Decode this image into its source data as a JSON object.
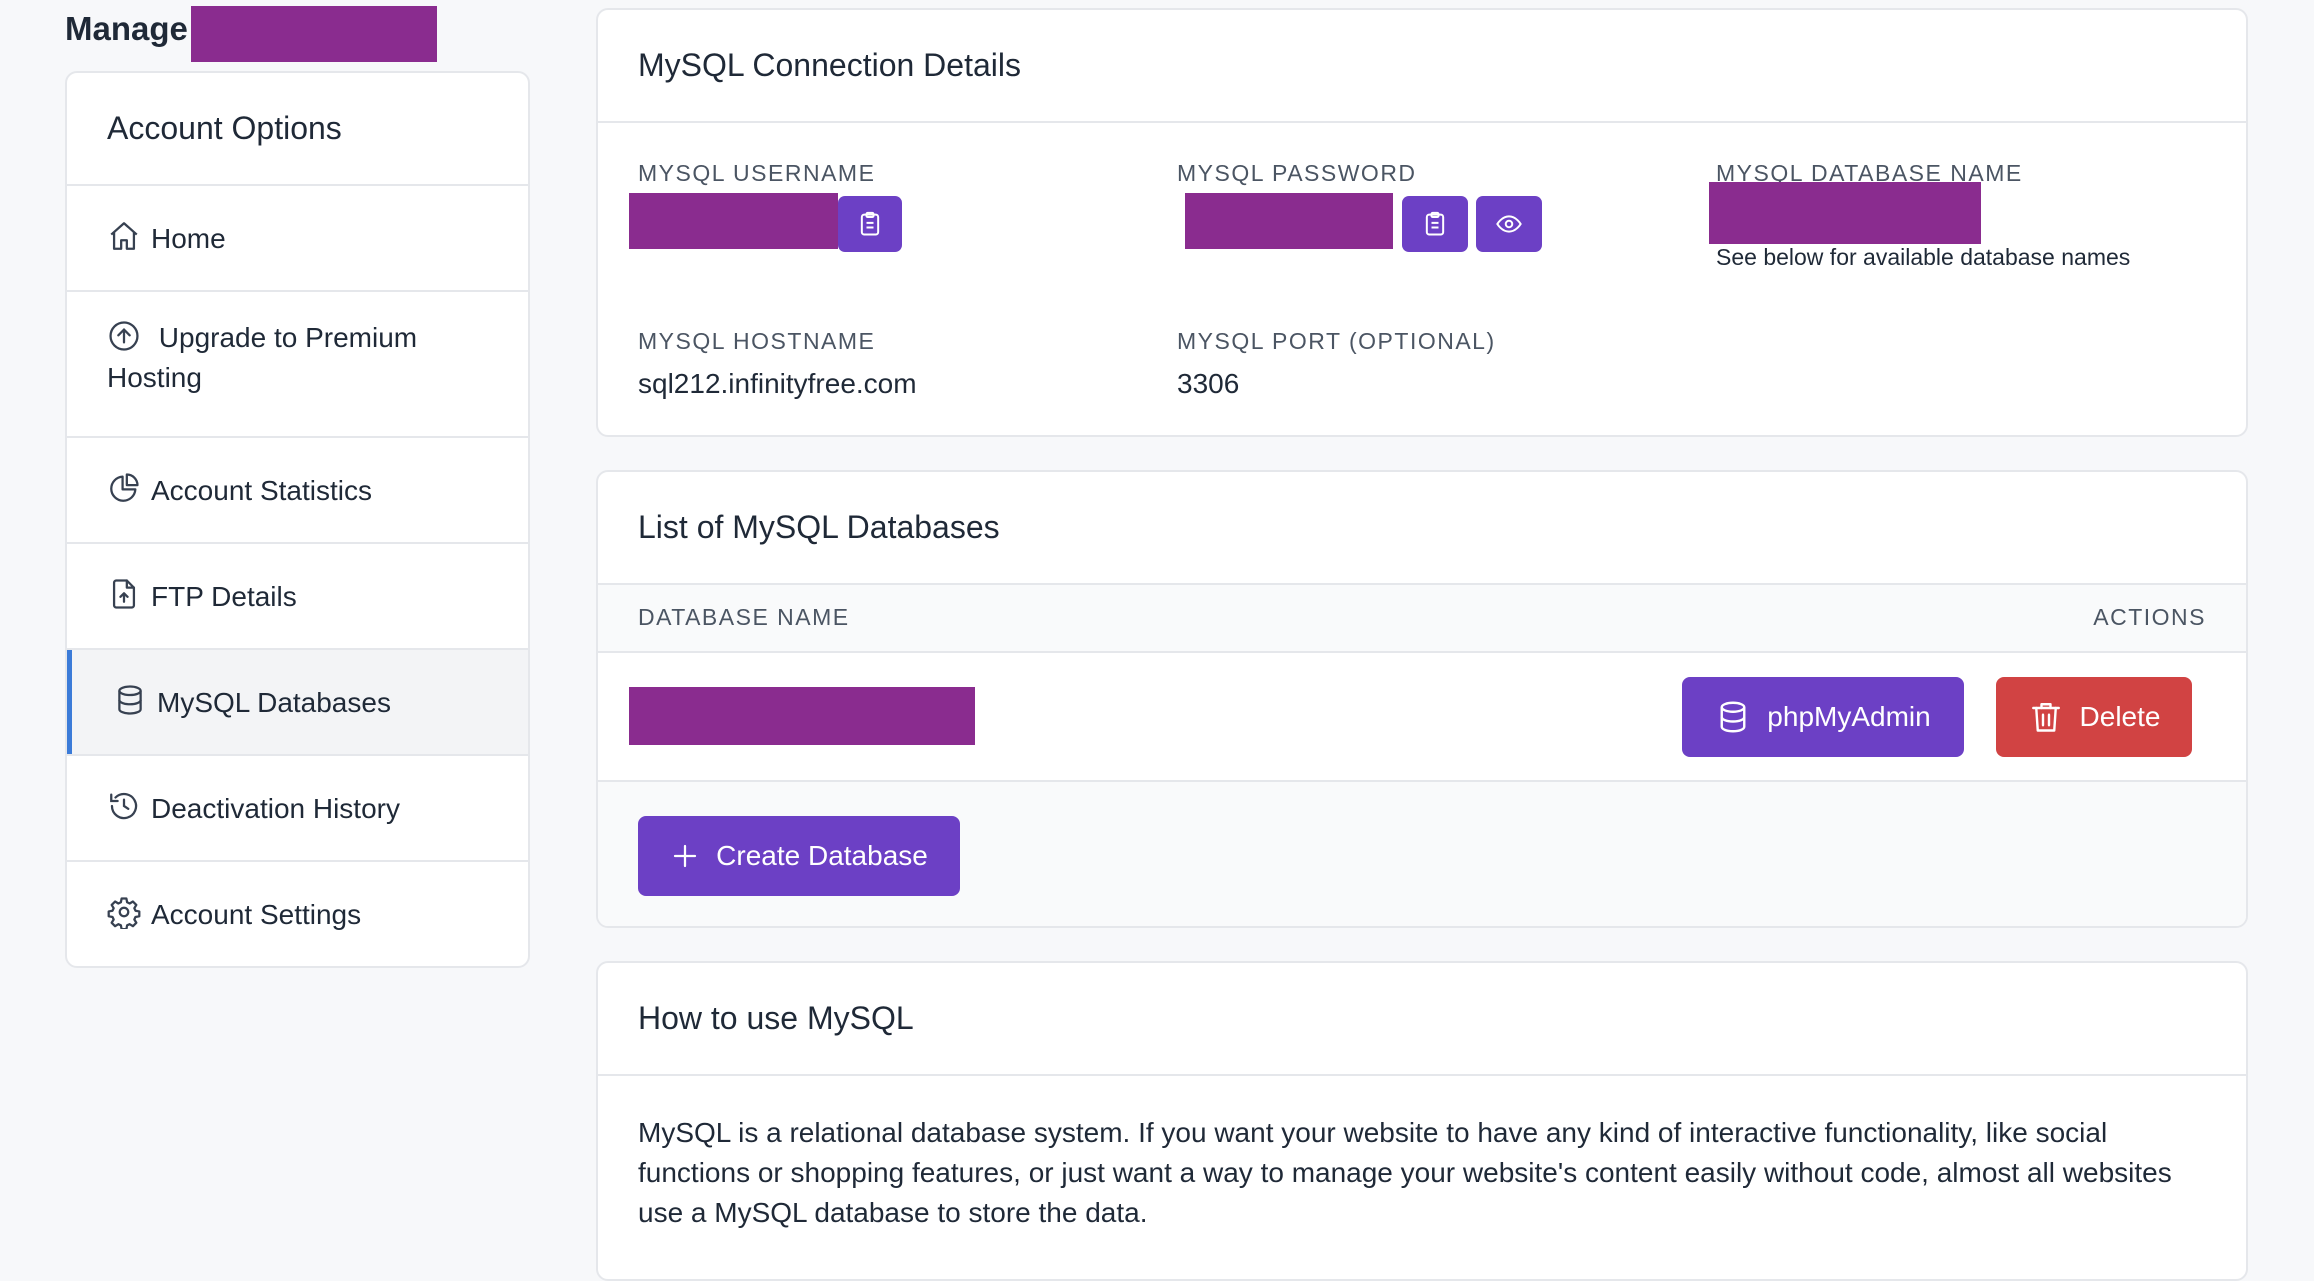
{
  "page": {
    "title": "Manage"
  },
  "sidebar": {
    "heading": "Account Options",
    "items": [
      {
        "label": "Home",
        "icon": "home-icon"
      },
      {
        "label": "Upgrade to Premium Hosting",
        "icon": "arrow-up-circle-icon"
      },
      {
        "label": "Account Statistics",
        "icon": "pie-chart-icon"
      },
      {
        "label": "FTP Details",
        "icon": "file-upload-icon"
      },
      {
        "label": "MySQL Databases",
        "icon": "database-icon",
        "active": true
      },
      {
        "label": "Deactivation History",
        "icon": "history-icon"
      },
      {
        "label": "Account Settings",
        "icon": "gear-icon"
      }
    ]
  },
  "connection": {
    "title": "MySQL Connection Details",
    "username_label": "MYSQL USERNAME",
    "password_label": "MYSQL PASSWORD",
    "dbname_label": "MYSQL DATABASE NAME",
    "dbname_hint": "See below for available database names",
    "hostname_label": "MYSQL HOSTNAME",
    "hostname_value": "sql212.infinityfree.com",
    "port_label": "MYSQL PORT (OPTIONAL)",
    "port_value": "3306"
  },
  "databases": {
    "title": "List of MySQL Databases",
    "col_name": "DATABASE NAME",
    "col_actions": "ACTIONS",
    "phpmyadmin_label": "phpMyAdmin",
    "delete_label": "Delete",
    "create_label": "Create Database"
  },
  "howto": {
    "title": "How to use MySQL",
    "body": "MySQL is a relational database system. If you want your website to have any kind of interactive functionality, like social functions or shopping features, or just want a way to manage your website's content easily without code, almost all websites use a MySQL database to store the data."
  },
  "colors": {
    "accent": "#6c40c5",
    "danger": "#d14343",
    "redaction": "#8a2c8f",
    "active_bar": "#3b7bd8"
  }
}
